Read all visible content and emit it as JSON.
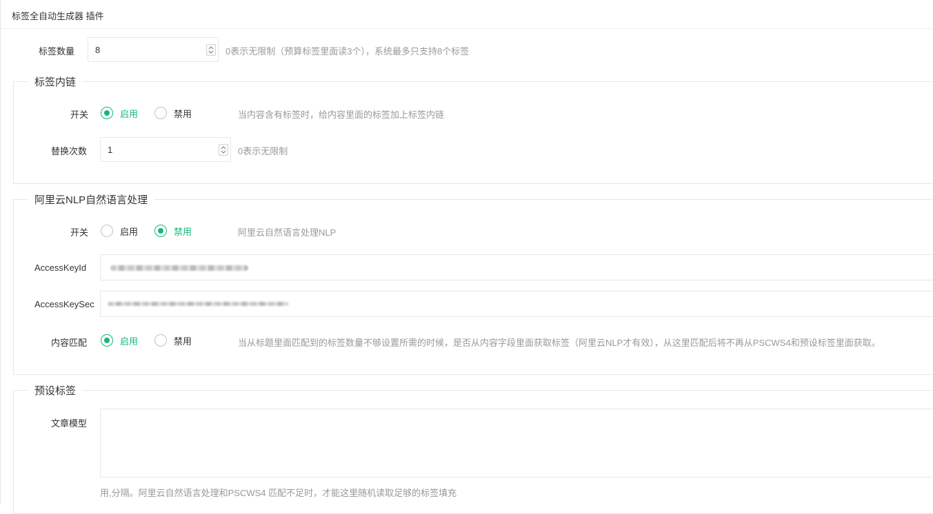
{
  "header": {
    "title": "标签全自动生成器 插件"
  },
  "tag_count": {
    "label": "标签数量",
    "value": "8",
    "hint": "0表示无限制（预算标签里面读3个），系统最多只支持8个标签"
  },
  "inner_link": {
    "legend": "标签内链",
    "switch": {
      "label": "开关",
      "options": [
        "启用",
        "禁用"
      ],
      "selected": "启用",
      "hint": "当内容含有标签时，给内容里面的标签加上标签内链"
    },
    "replace": {
      "label": "替换次数",
      "value": "1",
      "hint": "0表示无限制"
    }
  },
  "nlp": {
    "legend": "阿里云NLP自然语言处理",
    "switch": {
      "label": "开关",
      "options": [
        "启用",
        "禁用"
      ],
      "selected": "禁用",
      "hint": "阿里云自然语言处理NLP"
    },
    "access_key_id": {
      "label": "AccessKeyId"
    },
    "access_key_secret": {
      "label": "AccessKeySec"
    },
    "content_match": {
      "label": "内容匹配",
      "options": [
        "启用",
        "禁用"
      ],
      "selected": "启用",
      "hint": "当从标题里面匹配到的标签数量不够设置所需的时候，是否从内容字段里面获取标签（阿里云NLP才有效），从这里匹配后将不再从PSCWS4和预设标签里面获取。"
    }
  },
  "preset": {
    "legend": "预设标签",
    "article_model": {
      "label": "文章模型",
      "value": ""
    },
    "hint": "用,分隔。阿里云自然语言处理和PSCWS4 匹配不足时，才能这里随机读取足够的标签填充"
  },
  "colors": {
    "accent": "#16b777",
    "border": "#e6e6e6",
    "hint": "#999999"
  }
}
